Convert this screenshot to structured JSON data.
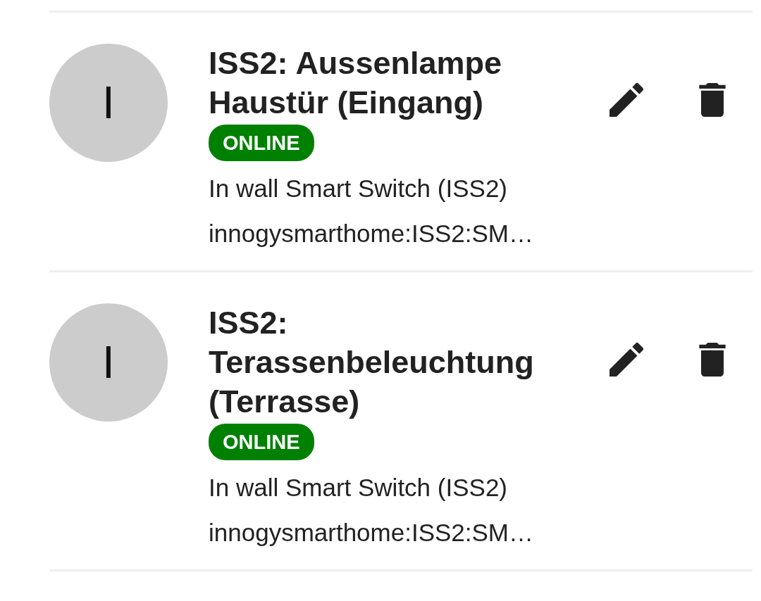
{
  "things": [
    {
      "avatar_letter": "I",
      "title": "ISS2: Aussenlampe Haustür (Eingang)",
      "status": "ONLINE",
      "type": "In wall Smart Switch (ISS2)",
      "uid": "innogysmarthome:ISS2:SM…"
    },
    {
      "avatar_letter": "I",
      "title": "ISS2: Terassenbeleuchtung (Terrasse)",
      "status": "ONLINE",
      "type": "In wall Smart Switch (ISS2)",
      "uid": "innogysmarthome:ISS2:SM…"
    }
  ]
}
